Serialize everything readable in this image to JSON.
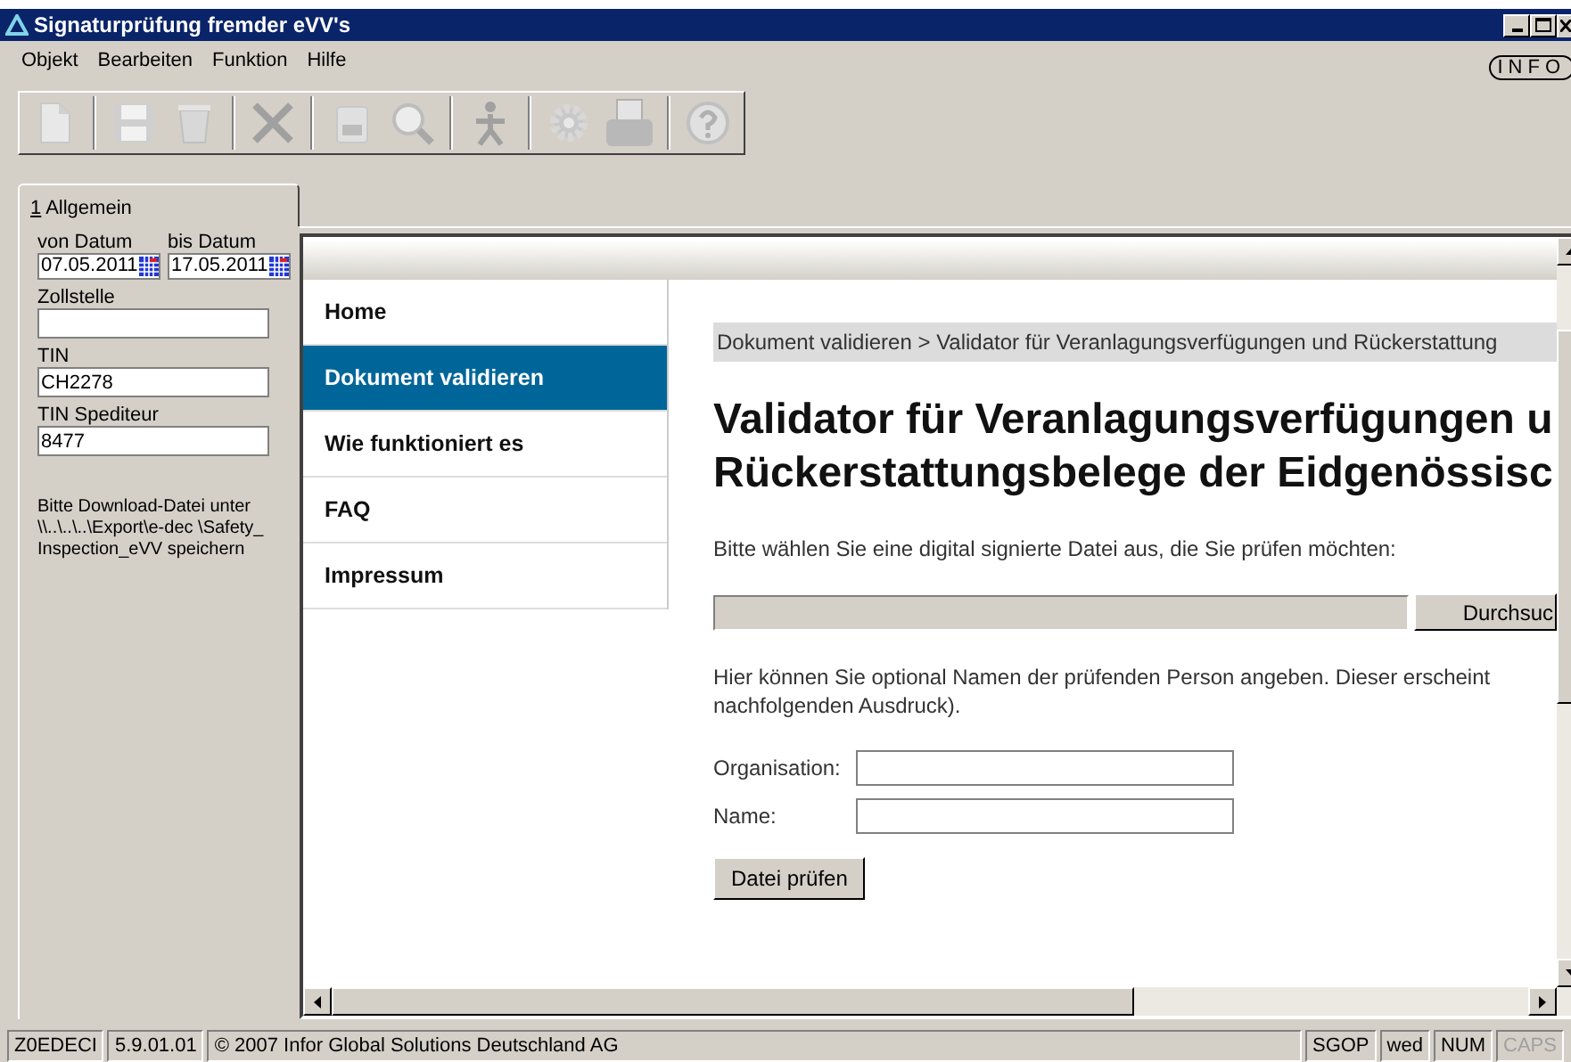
{
  "window": {
    "title": "Signaturprüfung fremder eVV's"
  },
  "menu": [
    "Objekt",
    "Bearbeiten",
    "Funktion",
    "Hilfe"
  ],
  "logo": "INFO",
  "toolbar": [
    [
      {
        "kind": "document"
      }
    ],
    [
      {
        "kind": "save"
      },
      {
        "kind": "trash"
      }
    ],
    [
      {
        "kind": "tools"
      }
    ],
    [
      {
        "kind": "calendar"
      },
      {
        "kind": "search"
      }
    ],
    [
      {
        "kind": "person"
      }
    ],
    [
      {
        "kind": "gear"
      },
      {
        "kind": "printer"
      }
    ],
    [
      {
        "kind": "help"
      }
    ]
  ],
  "tabs": [
    {
      "accelerator": "1",
      "label": "Allgemein",
      "selected": true
    }
  ],
  "filters": {
    "date_from": {
      "label": "von Datum",
      "value": "07.05.2011"
    },
    "date_to": {
      "label": "bis Datum",
      "value": "17.05.2011"
    },
    "fields": [
      {
        "label": "Zollstelle"
      },
      {
        "label": "TIN",
        "value": "CH2278"
      },
      {
        "label": "TIN Spediteur",
        "value": "8477"
      }
    ],
    "note": "Bitte Download-Datei unter \\\\..\\..\\..\\Export\\e-dec \\Safety_Inspection_eVV speichern"
  },
  "web": {
    "nav": [
      {
        "label": "Home",
        "selected": false
      },
      {
        "label": "Dokument validieren",
        "selected": true
      },
      {
        "label": "Wie funktioniert es",
        "selected": false
      },
      {
        "label": "FAQ",
        "selected": false
      },
      {
        "label": "Impressum",
        "selected": false
      }
    ],
    "breadcrumb": "Dokument validieren > Validator für Veranlagungsverfügungen und Rückerstattung",
    "heading": [
      "Validator für Veranlagungsverfügungen u",
      "Rückerstattungsbelege der Eidgenössisc"
    ],
    "instruction": "Bitte wählen Sie eine digital signierte Datei aus, die Sie prüfen möchten:",
    "browse_button": "Durchsuc",
    "optional_text": [
      "Hier können Sie optional Namen der prüfenden Person angeben. Dieser erscheint",
      "nachfolgenden Ausdruck)."
    ],
    "form": [
      {
        "label": "Organisation:"
      },
      {
        "label": "Name:"
      }
    ],
    "submit": "Datei prüfen"
  },
  "status_bar": {
    "left": [
      {
        "text": "Z0EDECI",
        "disabled": false
      },
      {
        "text": "5.9.01.01",
        "disabled": false
      },
      {
        "text": "© 2007 Infor Global Solutions Deutschland AG",
        "disabled": false
      }
    ],
    "right": [
      {
        "text": "SGOP",
        "disabled": false
      },
      {
        "text": "wed",
        "disabled": false
      },
      {
        "text": "NUM",
        "disabled": false
      },
      {
        "text": "CAPS",
        "disabled": true
      }
    ]
  }
}
